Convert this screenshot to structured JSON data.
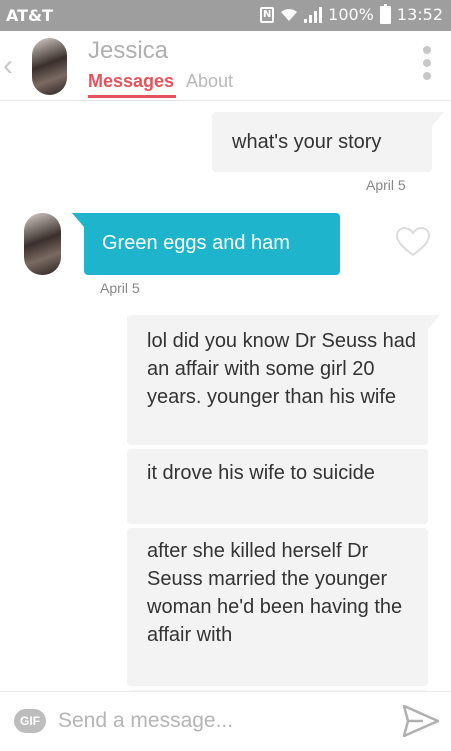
{
  "status_bar": {
    "carrier": "AT&T",
    "nfc": "N",
    "battery": "100%",
    "time": "13:52"
  },
  "header": {
    "name": "Jessica",
    "tabs": {
      "messages": "Messages",
      "about": "About"
    },
    "icons": {
      "back": "chevron-left-icon",
      "more": "more-vertical-icon"
    },
    "accent_color": "#e5545c"
  },
  "messages": [
    {
      "direction": "outgoing",
      "text": "what's your story"
    },
    {
      "direction": "incoming",
      "text": "Green eggs and ham"
    },
    {
      "direction": "outgoing",
      "text": "lol did you know Dr Seuss had an affair with some girl 20 years. younger than his wife"
    },
    {
      "direction": "outgoing",
      "text": "it drove his wife to suicide"
    },
    {
      "direction": "outgoing",
      "text": "after she killed herself Dr Seuss married the younger woman he'd been having the affair with"
    }
  ],
  "dates": {
    "first": "April 5",
    "second": "April 5"
  },
  "colors": {
    "incoming_bubble": "#1eb5cc",
    "outgoing_bubble": "#f3f3f3"
  },
  "composer": {
    "gif_label": "GIF",
    "placeholder": "Send a message...",
    "send_icon": "send-icon"
  }
}
